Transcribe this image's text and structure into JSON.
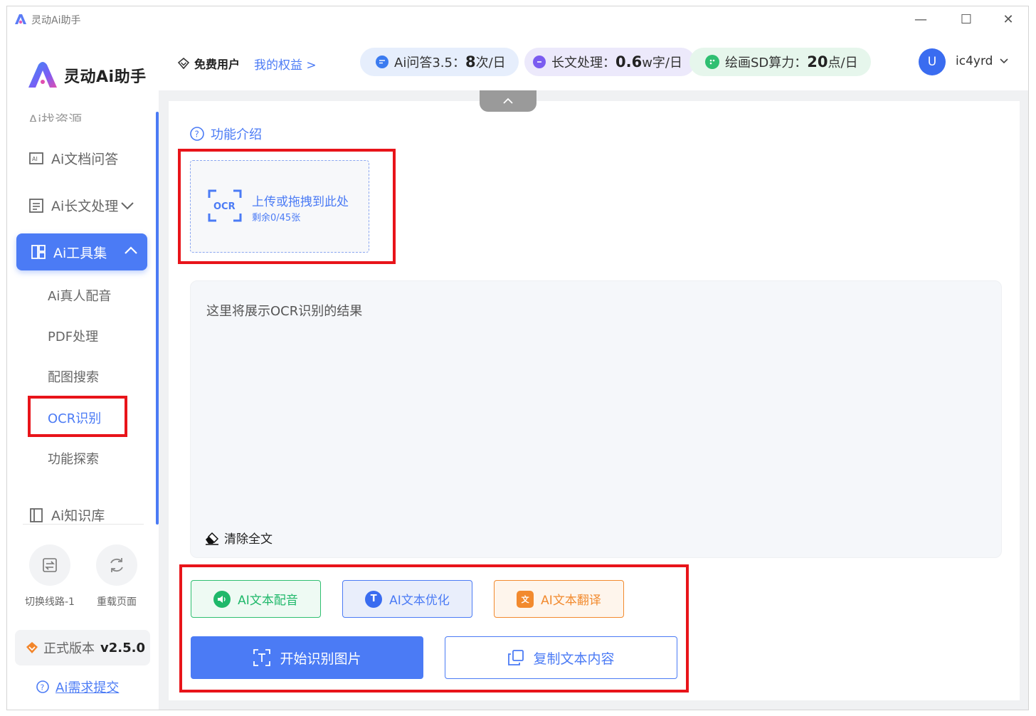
{
  "window": {
    "title": "灵动Ai助手",
    "controls": {
      "minimize": "—",
      "maximize": "☐",
      "close": "✕"
    }
  },
  "sidebar": {
    "brand": "灵动Ai助手",
    "cut_item": "Ai找资源",
    "items": [
      {
        "label": "Ai文档问答",
        "icon": "doc-qa-icon"
      },
      {
        "label": "Ai长文处理",
        "icon": "long-text-icon"
      }
    ],
    "active_group": {
      "label": "Ai工具集",
      "icon": "toolbox-icon"
    },
    "sub_items": [
      "Ai真人配音",
      "PDF处理",
      "配图搜索",
      "OCR识别",
      "功能探索"
    ],
    "selected_sub": "OCR识别",
    "knowledge": "Ai知识库",
    "tools": [
      {
        "label": "切换线路-1",
        "icon": "switch-line-icon"
      },
      {
        "label": "重载页面",
        "icon": "reload-icon"
      }
    ],
    "version_label": "正式版本",
    "version_number": "v2.5.0",
    "feedback": "Ai需求提交"
  },
  "topbar": {
    "user_type": "免费用户",
    "rights_link": "我的权益 >",
    "quotas": [
      {
        "label": "Ai问答3.5：",
        "value": "8",
        "unit": "次/日",
        "color": "#e6eefc",
        "icon_color": "#3b7bf0"
      },
      {
        "label": "长文处理：",
        "value": "0.6",
        "unit": "w字/日",
        "color": "#ece9fb",
        "icon_color": "#7b5cf0"
      },
      {
        "label": "绘画SD算力：",
        "value": "20",
        "unit": "点/日",
        "color": "#e6f6ec",
        "icon_color": "#2fbf71"
      }
    ],
    "avatar_letter": "U",
    "username": "ic4yrd"
  },
  "main": {
    "intro_link": "功能介绍",
    "upload": {
      "icon_text": "OCR",
      "title": "上传或拖拽到此处",
      "remaining": "剩余0/45张"
    },
    "result_placeholder": "这里将展示OCR识别的结果",
    "clear_label": "清除全文",
    "ai_buttons": [
      {
        "label": "AI文本配音",
        "icon": "speaker-icon"
      },
      {
        "label": "AI文本优化",
        "icon": "T"
      },
      {
        "label": "AI文本翻译",
        "icon": "文"
      }
    ],
    "start_button": "开始识别图片",
    "copy_button": "复制文本内容"
  },
  "colors": {
    "accent": "#4b7bf5",
    "highlight_box": "#e8141a",
    "green": "#1fb86a",
    "orange": "#f28a2e"
  }
}
